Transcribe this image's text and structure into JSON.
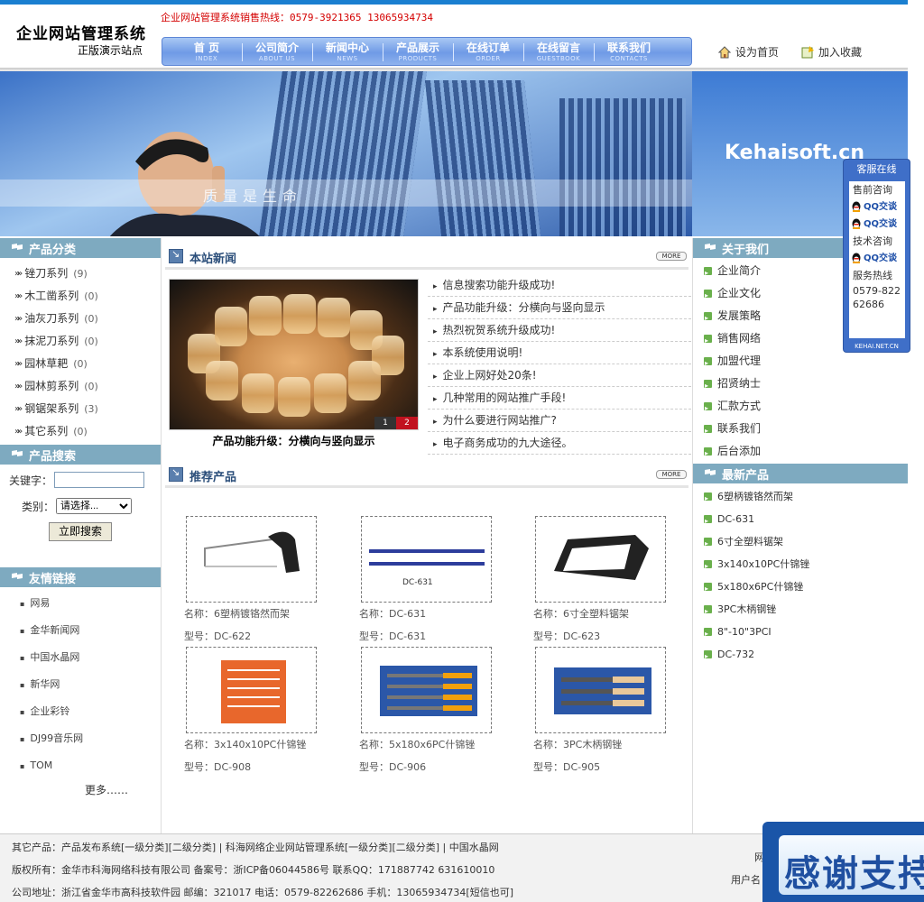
{
  "header": {
    "title": "企业网站管理系统",
    "subtitle": "正版演示站点",
    "hotline": "企业网站管理系统销售热线：0579-3921365 13065934734"
  },
  "nav": [
    {
      "label": "首 页",
      "en": "INDEX"
    },
    {
      "label": "公司简介",
      "en": "ABOUT US"
    },
    {
      "label": "新闻中心",
      "en": "NEWS"
    },
    {
      "label": "产品展示",
      "en": "PRODUCTS"
    },
    {
      "label": "在线订单",
      "en": "ORDER"
    },
    {
      "label": "在线留言",
      "en": "GUESTBOOK"
    },
    {
      "label": "联系我们",
      "en": "CONTACTS"
    }
  ],
  "quick": {
    "home": "设为首页",
    "fav": "加入收藏"
  },
  "banner": {
    "slogan": "质量是生命",
    "site": "Kehaisoft.cn"
  },
  "left": {
    "cat_title": "产品分类",
    "categories": [
      {
        "name": "锉刀系列",
        "count": "(9)"
      },
      {
        "name": "木工凿系列",
        "count": "(0)"
      },
      {
        "name": "油灰刀系列",
        "count": "(0)"
      },
      {
        "name": "抹泥刀系列",
        "count": "(0)"
      },
      {
        "name": "园林草耙",
        "count": "(0)"
      },
      {
        "name": "园林剪系列",
        "count": "(0)"
      },
      {
        "name": "钢锯架系列",
        "count": "(3)"
      },
      {
        "name": "其它系列",
        "count": "(0)"
      }
    ],
    "search_title": "产品搜索",
    "keyword_label": "关键字：",
    "category_label": "类别：",
    "category_value": "请选择...",
    "search_button": "立即搜索",
    "links_title": "友情链接",
    "links": [
      "网易",
      "金华新闻网",
      "中国水晶网",
      "新华网",
      "企业彩铃",
      "DJ99音乐网",
      "TOM"
    ],
    "more": "更多……"
  },
  "center": {
    "news_title": "本站新闻",
    "more": "MORE",
    "photo_caption": "产品功能升级：分横向与竖向显示",
    "pager": [
      "1",
      "2"
    ],
    "news": [
      "信息搜索功能升级成功!",
      "产品功能升级：分横向与竖向显示",
      "热烈祝贺系统升级成功!",
      "本系统使用说明!",
      "企业上网好处20条!",
      "几种常用的网站推广手段!",
      "为什么要进行网站推广?",
      "电子商务成功的九大途径。"
    ],
    "products_title": "推荐产品",
    "name_label": "名称：",
    "model_label": "型号：",
    "products": [
      {
        "name": "6塑柄镀铬然而架",
        "model": "DC-622",
        "icon": "hacksaw-icon"
      },
      {
        "name": "DC-631",
        "model": "DC-631",
        "icon": "saw-blade-icon",
        "blade_label": "DC-631"
      },
      {
        "name": "6寸全塑料锯架",
        "model": "DC-623",
        "icon": "hacksaw-icon"
      },
      {
        "name": "3x140x10PC什锦锉",
        "model": "DC-908",
        "icon": "file-set-icon"
      },
      {
        "name": "5x180x6PC什锦锉",
        "model": "DC-906",
        "icon": "file-set-icon"
      },
      {
        "name": "3PC木柄钢锉",
        "model": "DC-905",
        "icon": "file-set-icon"
      }
    ]
  },
  "right": {
    "about_title": "关于我们",
    "about": [
      "企业简介",
      "企业文化",
      "发展策略",
      "销售网络",
      "加盟代理",
      "招贤纳士",
      "汇款方式",
      "联系我们",
      "后台添加"
    ],
    "new_title": "最新产品",
    "new_products": [
      "6塑柄镀铬然而架",
      "DC-631",
      "6寸全塑料锯架",
      "3x140x10PC什锦锉",
      "5x180x6PC什锦锉",
      "3PC木柄钢锉",
      "8\"-10\"3PCI",
      "DC-732"
    ]
  },
  "kefu": {
    "title": "客服在线",
    "presale": "售前咨询",
    "qq": "QQ交谈",
    "tech": "技术咨询",
    "hotline_label": "服务热线",
    "hotline": "0579-82262686",
    "footer": "KEHAI.NET.CN"
  },
  "footer": {
    "line1": "其它产品：产品发布系统[一级分类][二级分类] | 科海网络企业网站管理系统[一级分类][二级分类] | 中国水晶网",
    "line2": "版权所有：金华市科海网络科技有限公司  备案号：浙ICP备06044586号  联系QQ：171887742   631610010",
    "line3": "公司地址：浙江省金华市高科技软件园 邮编：321017 电话：0579-82262686 手机：13065934734[短信也可]",
    "wang": "网",
    "user": "用户名",
    "thanks": "感谢支持"
  },
  "colors": {
    "accent": "#1a7fd0",
    "section": "#7eaac0",
    "hotline": "#d40000"
  }
}
